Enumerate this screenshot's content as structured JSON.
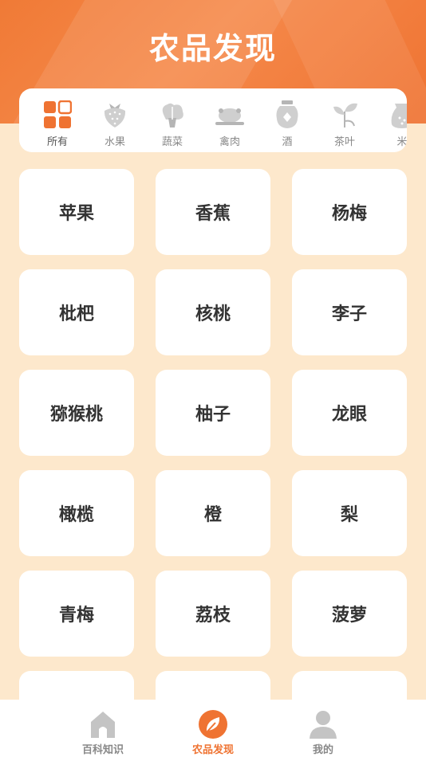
{
  "header": {
    "title": "农品发现",
    "accent": "#ef7332"
  },
  "categories": [
    {
      "label": "所有",
      "icon": "grid-icon"
    },
    {
      "label": "水果",
      "icon": "strawberry-icon"
    },
    {
      "label": "蔬菜",
      "icon": "cabbage-icon"
    },
    {
      "label": "禽肉",
      "icon": "roast-chicken-icon"
    },
    {
      "label": "酒",
      "icon": "wine-jar-icon"
    },
    {
      "label": "茶叶",
      "icon": "tea-leaf-icon"
    },
    {
      "label": "米",
      "icon": "rice-sack-icon"
    }
  ],
  "products": [
    "苹果",
    "香蕉",
    "杨梅",
    "枇杷",
    "核桃",
    "李子",
    "猕猴桃",
    "柚子",
    "龙眼",
    "橄榄",
    "橙",
    "梨",
    "青梅",
    "荔枝",
    "菠萝",
    "",
    "",
    ""
  ],
  "tabbar": {
    "items": [
      {
        "label": "百科知识",
        "icon": "house-icon"
      },
      {
        "label": "农品发现",
        "icon": "leaf-icon",
        "active": true
      },
      {
        "label": "我的",
        "icon": "person-icon"
      }
    ]
  }
}
